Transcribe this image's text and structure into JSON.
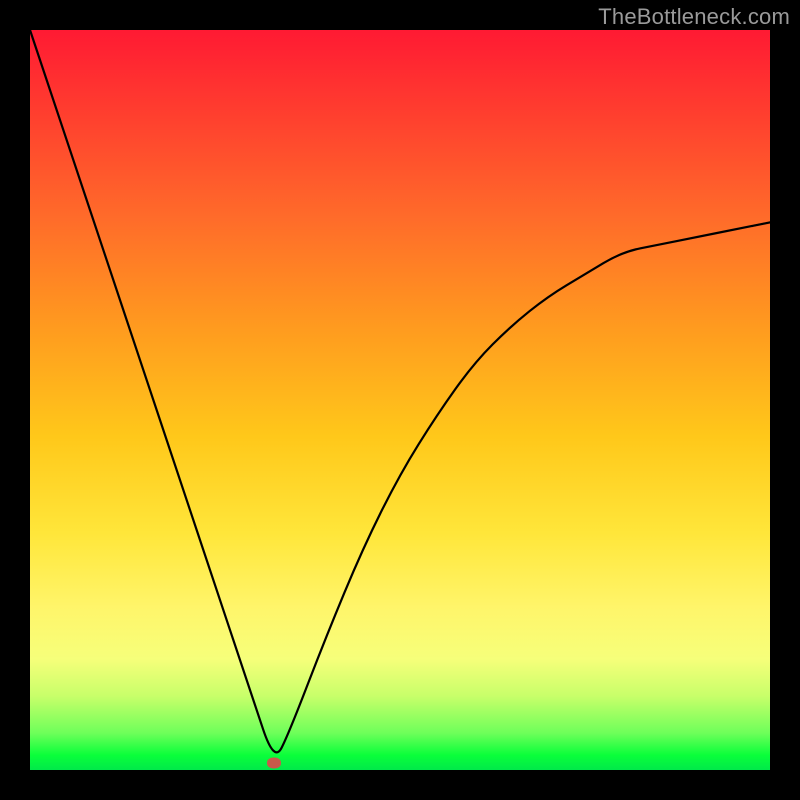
{
  "watermark": "TheBottleneck.com",
  "colors": {
    "curve": "#000000",
    "marker": "#c85a4a",
    "frame": "#000000"
  },
  "chart_data": {
    "type": "line",
    "title": "",
    "xlabel": "",
    "ylabel": "",
    "xlim": [
      0,
      100
    ],
    "ylim": [
      0,
      100
    ],
    "grid": false,
    "series": [
      {
        "name": "bottleneck-curve",
        "x": [
          0,
          5,
          10,
          15,
          20,
          25,
          30,
          33,
          35,
          40,
          45,
          50,
          55,
          60,
          65,
          70,
          75,
          80,
          85,
          90,
          95,
          100
        ],
        "values": [
          100,
          85,
          70,
          55,
          40,
          25,
          10,
          1,
          5,
          18,
          30,
          40,
          48,
          55,
          60,
          64,
          67,
          70,
          71,
          72,
          73,
          74
        ]
      }
    ],
    "marker": {
      "x": 33,
      "y": 1
    },
    "background_gradient": {
      "top": "#ff1a33",
      "mid": "#ffe63a",
      "bottom": "#00e94a"
    }
  }
}
